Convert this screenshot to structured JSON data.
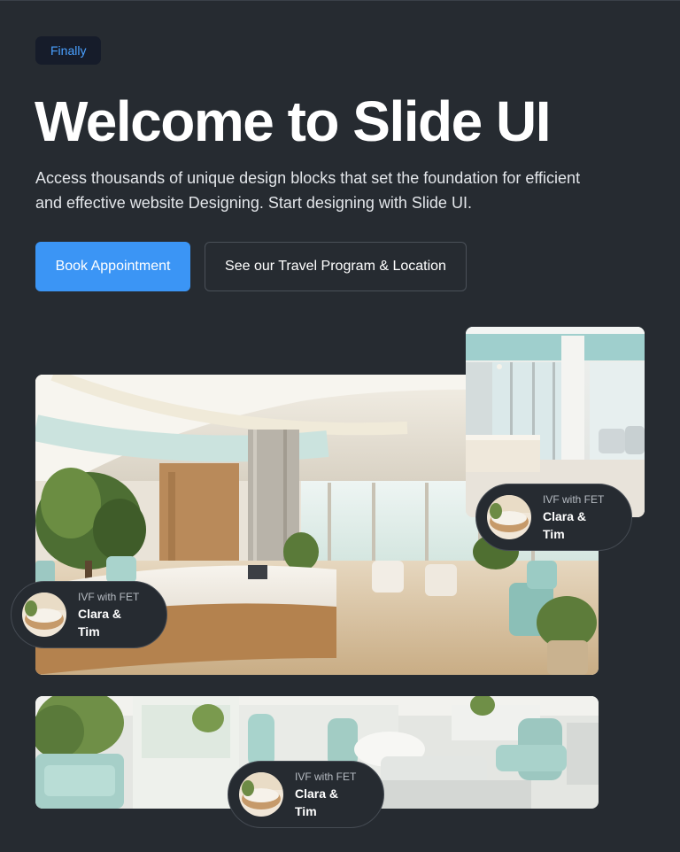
{
  "hero": {
    "badge": "Finally",
    "title": "Welcome to Slide UI",
    "description": "Access thousands of unique design blocks that set the foundation for efficient and effective website Designing. Start designing with Slide UI.",
    "primary_button": "Book Appointment",
    "secondary_button": "See our Travel Program & Location"
  },
  "testimonials": [
    {
      "label": "IVF with FET",
      "names": "Clara & Tim"
    },
    {
      "label": "IVF with FET",
      "names": "Clara & Tim"
    },
    {
      "label": "IVF with FET",
      "names": "Clara & Tim"
    }
  ],
  "colors": {
    "background": "#262b31",
    "primary": "#3b95f5",
    "badge_text": "#4aa0ff",
    "badge_bg": "#161c2a"
  }
}
